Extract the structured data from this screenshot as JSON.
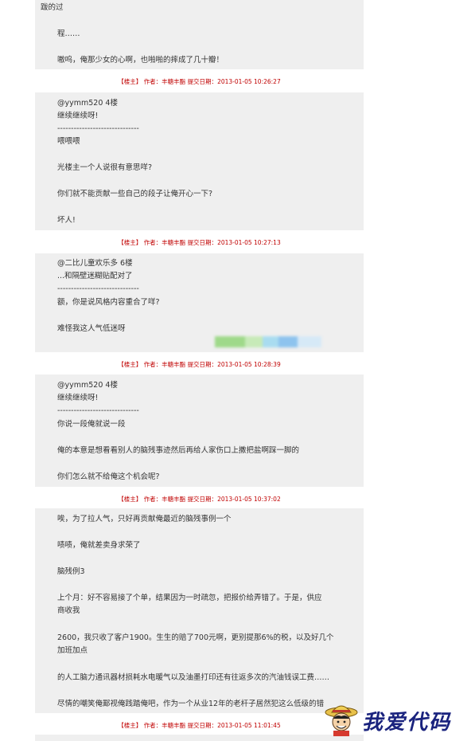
{
  "post0": {
    "lines": [
      "跋的过",
      "程……",
      "嗷呜，俺那少女的心啊，也啪啪的摔成了几十瓣！"
    ]
  },
  "meta1": {
    "tag": "【楼主】",
    "author_label": "作者：",
    "author": "丰糖丰酯",
    "date_label": "提交日期：",
    "date": "2013-01-05 10:26:27"
  },
  "post1": {
    "lines": [
      "@yymm520 4楼",
      "继续继续呀!",
      "------------------------------",
      "喂喂喂",
      "光楼主一个人说很有意思咩?",
      "你们就不能贡献一些自己的段子让俺开心一下?",
      "坏人!"
    ]
  },
  "meta2": {
    "tag": "【楼主】",
    "author_label": "作者：",
    "author": "丰糖丰酯",
    "date_label": "提交日期：",
    "date": "2013-01-05 10:27:13"
  },
  "post2": {
    "lines": [
      "@二比儿童欢乐多 6楼",
      "...和隔壁迷糊贴配对了",
      "------------------------------",
      "额，你是说风格内容重合了咩?",
      "难怪我这人气低迷呀"
    ]
  },
  "meta3": {
    "tag": "【楼主】",
    "author_label": "作者：",
    "author": "丰糖丰酯",
    "date_label": "提交日期：",
    "date": "2013-01-05 10:28:39"
  },
  "post3": {
    "lines": [
      "@yymm520 4楼",
      "继续继续呀!",
      "------------------------------",
      "你说一段俺就说一段",
      "俺的本意是想看看别人的脑残事迹然后再给人家伤口上撒把盐啊踩一脚的",
      "你们怎么就不给俺这个机会呢?"
    ]
  },
  "meta4": {
    "tag": "【楼主】",
    "author_label": "作者：",
    "author": "丰糖丰酯",
    "date_label": "提交日期：",
    "date": "2013-01-05 10:37:02"
  },
  "post4": {
    "lines": [
      "唉，为了拉人气，只好再贡献俺最近的脑残事例一个",
      "啧啧，俺就差卖身求荣了",
      "脑残例3",
      "上个月：好不容易接了个单，结果因为一时疏忽，把报价给弄错了。于是，供应",
      "商收我",
      "2600，我只收了客户1900。生生的赔了700元啊，更别提那6%的税，以及好几个",
      "加班加点",
      "的人工脑力通讯器材损耗水电暖气以及油墨打印还有往返多次的汽油钱误工费……",
      "尽情的嘲笑俺鄙视俺践踏俺吧，作为一个从业12年的老杆子居然犯这么低级的错"
    ]
  },
  "meta5": {
    "tag": "【楼主】",
    "author_label": "作者：",
    "author": "丰糖丰酯",
    "date_label": "提交日期：",
    "date": "2013-01-05 11:01:45"
  },
  "watermark": {
    "text": "我爱代码",
    "logo": "straw-hat-pirate-logo"
  },
  "colors": {
    "post_bg": "#efefef",
    "meta_red": "#c00000",
    "watermark_blue": "#1a237e"
  }
}
